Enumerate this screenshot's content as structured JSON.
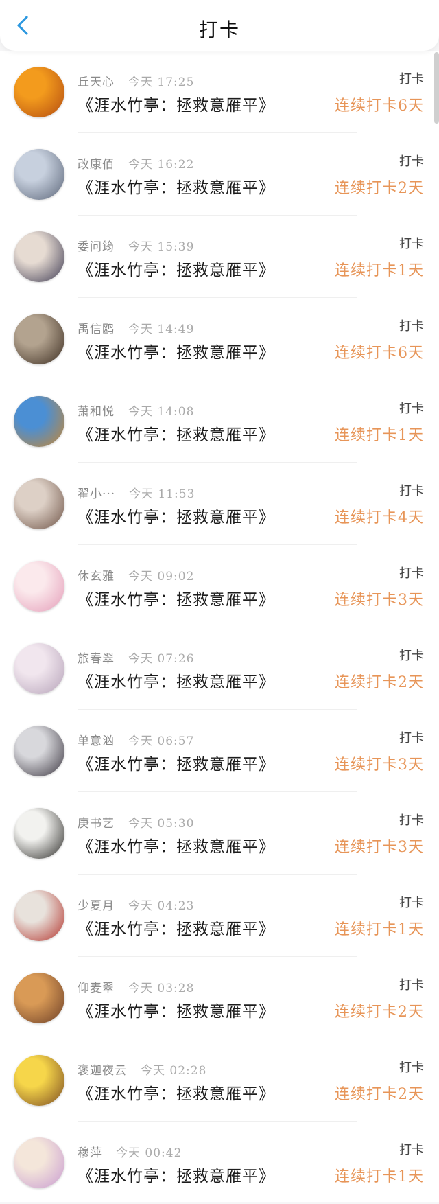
{
  "header": {
    "title": "打卡",
    "back_icon": "chevron-left-icon",
    "accent": "#2c98e0"
  },
  "colors": {
    "streak": "#e79558"
  },
  "items": [
    {
      "name": "丘天心",
      "time": "今天 17:25",
      "content": "《涯水竹亭：拯救意雁平》",
      "tag": "打卡",
      "streak": "连续打卡6天",
      "avatar_colors": [
        "#f39b1d",
        "#b24a10"
      ]
    },
    {
      "name": "改康佰",
      "time": "今天 16:22",
      "content": "《涯水竹亭：拯救意雁平》",
      "tag": "打卡",
      "streak": "连续打卡2天",
      "avatar_colors": [
        "#c7d0de",
        "#5b6578"
      ]
    },
    {
      "name": "委问筠",
      "time": "今天 15:39",
      "content": "《涯水竹亭：拯救意雁平》",
      "tag": "打卡",
      "streak": "连续打卡1天",
      "avatar_colors": [
        "#e6dbd2",
        "#3d3a52"
      ]
    },
    {
      "name": "禹信鸥",
      "time": "今天 14:49",
      "content": "《涯水竹亭：拯救意雁平》",
      "tag": "打卡",
      "streak": "连续打卡6天",
      "avatar_colors": [
        "#b3a38f",
        "#3b2c20"
      ]
    },
    {
      "name": "萧和悦",
      "time": "今天 14:08",
      "content": "《涯水竹亭：拯救意雁平》",
      "tag": "打卡",
      "streak": "连续打卡1天",
      "avatar_colors": [
        "#4b8fd4",
        "#c9862f"
      ]
    },
    {
      "name": "翟小···",
      "time": "今天 11:53",
      "content": "《涯水竹亭：拯救意雁平》",
      "tag": "打卡",
      "streak": "连续打卡4天",
      "avatar_colors": [
        "#ddd0c6",
        "#6e5346"
      ]
    },
    {
      "name": "休玄雅",
      "time": "今天 09:02",
      "content": "《涯水竹亭：拯救意雁平》",
      "tag": "打卡",
      "streak": "连续打卡3天",
      "avatar_colors": [
        "#fbe9ec",
        "#e49cb8"
      ]
    },
    {
      "name": "旅春翠",
      "time": "今天 07:26",
      "content": "《涯水竹亭：拯救意雁平》",
      "tag": "打卡",
      "streak": "连续打卡2天",
      "avatar_colors": [
        "#f1e6ee",
        "#b5a2b8"
      ]
    },
    {
      "name": "单意汹",
      "time": "今天 06:57",
      "content": "《涯水竹亭：拯救意雁平》",
      "tag": "打卡",
      "streak": "连续打卡3天",
      "avatar_colors": [
        "#d8d8dc",
        "#3b3640"
      ]
    },
    {
      "name": "庚书艺",
      "time": "今天 05:30",
      "content": "《涯水竹亭：拯救意雁平》",
      "tag": "打卡",
      "streak": "连续打卡3天",
      "avatar_colors": [
        "#f2f2ef",
        "#2c2b28"
      ]
    },
    {
      "name": "少夏月",
      "time": "今天 04:23",
      "content": "《涯水竹亭：拯救意雁平》",
      "tag": "打卡",
      "streak": "连续打卡1天",
      "avatar_colors": [
        "#e8e2dc",
        "#b3322b"
      ]
    },
    {
      "name": "仰麦翠",
      "time": "今天 03:28",
      "content": "《涯水竹亭：拯救意雁平》",
      "tag": "打卡",
      "streak": "连续打卡2天",
      "avatar_colors": [
        "#d99a56",
        "#6a3d26"
      ]
    },
    {
      "name": "褒迦夜云",
      "time": "今天 02:28",
      "content": "《涯水竹亭：拯救意雁平》",
      "tag": "打卡",
      "streak": "连续打卡2天",
      "avatar_colors": [
        "#f6d64a",
        "#7a4a22"
      ]
    },
    {
      "name": "穆萍",
      "time": "今天 00:42",
      "content": "《涯水竹亭：拯救意雁平》",
      "tag": "打卡",
      "streak": "连续打卡1天",
      "avatar_colors": [
        "#f4e6da",
        "#c89ad1"
      ]
    }
  ]
}
